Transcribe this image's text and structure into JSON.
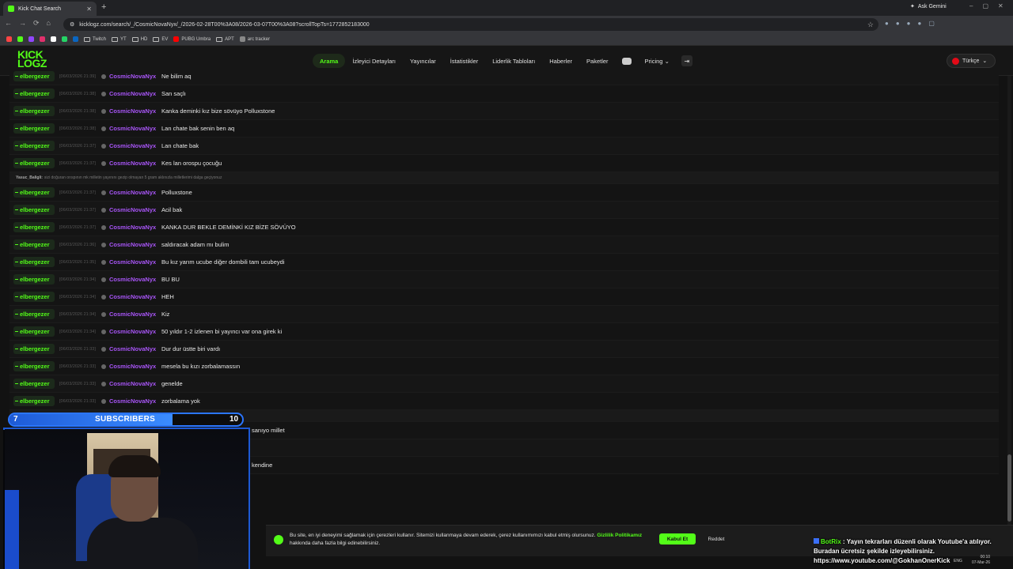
{
  "browser": {
    "tab_title": "Kick Chat Search",
    "ask_label": "Ask Gemini",
    "url": "kicklogz.com/search/_/CosmicNovaNyx/_/2026-02-28T00%3A08/2026-03-07T00%3A08?scrollTopTs=1772852183000",
    "bookmarks": [
      "Twitch",
      "YT",
      "HD",
      "EV",
      "PUBG Umbra",
      "APT",
      "arc tracker"
    ]
  },
  "site": {
    "logo_line1": "KICK",
    "logo_line2": "LOGZ",
    "nav": [
      "Arama",
      "İzleyici Detayları",
      "Yayıncılar",
      "İstatistikler",
      "Liderlik Tabloları",
      "Haberler",
      "Paketler",
      "Pricing"
    ],
    "active_nav": "Arama",
    "language": "Türkçe"
  },
  "chat": {
    "rows": [
      {
        "badge": "elbergezer",
        "ts": "[06/03/2026 21:39]",
        "user": "CosmicNovaNyx",
        "msg": "Ne bilim aq"
      },
      {
        "badge": "elbergezer",
        "ts": "[06/03/2026 21:38]",
        "user": "CosmicNovaNyx",
        "msg": "San saçlı"
      },
      {
        "badge": "elbergezer",
        "ts": "[06/03/2026 21:38]",
        "user": "CosmicNovaNyx",
        "msg": "Kanka deminki kız bize sövüyo Polluxstone"
      },
      {
        "badge": "elbergezer",
        "ts": "[06/03/2026 21:38]",
        "user": "CosmicNovaNyx",
        "msg": "Lan chate bak senin ben aq"
      },
      {
        "badge": "elbergezer",
        "ts": "[06/03/2026 21:37]",
        "user": "CosmicNovaNyx",
        "msg": "Lan chate bak"
      },
      {
        "badge": "elbergezer",
        "ts": "[06/03/2026 21:37]",
        "user": "CosmicNovaNyx",
        "msg": "Kes lan orospu çocuğu"
      },
      {
        "reply_user": "Yasuc_Baligli:",
        "reply_text": "sizi doğuran orıspının mk milletin yayınını gezip olmayan 5 gram aklınızla milletlerimi dalga geçiyonuz"
      },
      {
        "badge": "elbergezer",
        "ts": "[06/03/2026 21:37]",
        "user": "CosmicNovaNyx",
        "msg": "Polluxstone"
      },
      {
        "badge": "elbergezer",
        "ts": "[06/03/2026 21:37]",
        "user": "CosmicNovaNyx",
        "msg": "Acil bak"
      },
      {
        "badge": "elbergezer",
        "ts": "[06/03/2026 21:37]",
        "user": "CosmicNovaNyx",
        "msg": "KANKA DUR BEKLE DEMİNKİ KIZ BİZE SÖVÜYO"
      },
      {
        "badge": "elbergezer",
        "ts": "[06/03/2026 21:36]",
        "user": "CosmicNovaNyx",
        "msg": "saldıracak adam mı bulim"
      },
      {
        "badge": "elbergezer",
        "ts": "[06/03/2026 21:35]",
        "user": "CosmicNovaNyx",
        "msg": "Bu kız yarım ucube diğer dombili tam ucubeydi"
      },
      {
        "badge": "elbergezer",
        "ts": "[06/03/2026 21:34]",
        "user": "CosmicNovaNyx",
        "msg": "BU BU"
      },
      {
        "badge": "elbergezer",
        "ts": "[06/03/2026 21:34]",
        "user": "CosmicNovaNyx",
        "msg": "HEH"
      },
      {
        "badge": "elbergezer",
        "ts": "[06/03/2026 21:34]",
        "user": "CosmicNovaNyx",
        "msg": "Kiz"
      },
      {
        "badge": "elbergezer",
        "ts": "[06/03/2026 21:34]",
        "user": "CosmicNovaNyx",
        "msg": "50 yıldır 1-2 izlenen bi yayıncı var ona girek ki"
      },
      {
        "badge": "elbergezer",
        "ts": "[06/03/2026 21:33]",
        "user": "CosmicNovaNyx",
        "msg": "Dur dur üstte biri vardı"
      },
      {
        "badge": "elbergezer",
        "ts": "[06/03/2026 21:33]",
        "user": "CosmicNovaNyx",
        "msg": "mesela bu kızı zorbalamassın"
      },
      {
        "badge": "elbergezer",
        "ts": "[06/03/2026 21:33]",
        "user": "CosmicNovaNyx",
        "msg": "genelde"
      },
      {
        "badge": "elbergezer",
        "ts": "[06/03/2026 21:33]",
        "user": "CosmicNovaNyx",
        "msg": "zorbalama yok"
      },
      {
        "reply_user": "",
        "reply_text": ""
      },
      {
        "badge": "",
        "ts": "",
        "user": "",
        "msg": "sanıyo millet"
      },
      {
        "badge": "",
        "ts": "",
        "user": "",
        "msg": ""
      },
      {
        "badge": "",
        "ts": "",
        "user": "",
        "msg": "kendine"
      }
    ]
  },
  "cookie": {
    "text": "Bu site, en iyi deneyimi sağlamak için çerezleri kullanır. Sitemizi kullanmaya devam ederek, çerez kullanımımızı kabul etmiş olursunuz.",
    "link": "Gizlilik Politikamız",
    "after_link": "hakkında daha fazla bilgi edinebilirsiniz.",
    "accept": "Kabul Et",
    "reject": "Reddet"
  },
  "overlay": {
    "sub_current": "7",
    "sub_label": "SUBSCRIBERS",
    "sub_goal": "10",
    "sub_progress": 0.7,
    "botrix_name": "BotRix",
    "botrix_msg": ": Yayın tekrarları düzenli olarak Youtube'a atılıyor.",
    "botrix_line2": "Buradan ücretsiz şekilde izleyebilirsiniz.",
    "botrix_url": "https://www.youtube.com/@GokhanOnerKick"
  },
  "taskbar": {
    "lang": "ENG",
    "time": "00:10",
    "date": "07-Mar-26"
  },
  "colors": {
    "accent": "#53fc18",
    "username": "#a855f7",
    "sub_bar": "#2b76ff"
  }
}
